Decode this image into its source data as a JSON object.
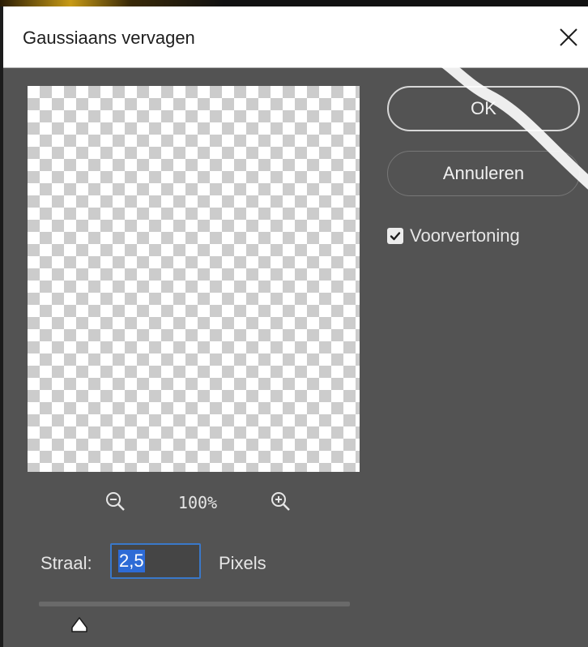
{
  "dialog": {
    "title": "Gaussiaans vervagen",
    "close_icon": "close-icon"
  },
  "preview": {
    "zoom_out_icon": "zoom-out-icon",
    "zoom_level": "100%",
    "zoom_in_icon": "zoom-in-icon"
  },
  "radius": {
    "label": "Straal:",
    "value": "2,5",
    "unit": "Pixels"
  },
  "buttons": {
    "ok_label": "OK",
    "cancel_label": "Annuleren"
  },
  "preview_toggle": {
    "label": "Voorvertoning",
    "checked": true
  },
  "colors": {
    "dialog_bg": "#535353",
    "titlebar_bg": "#ffffff",
    "accent_focus": "#3a78c9",
    "selection": "#2d6bd6"
  }
}
